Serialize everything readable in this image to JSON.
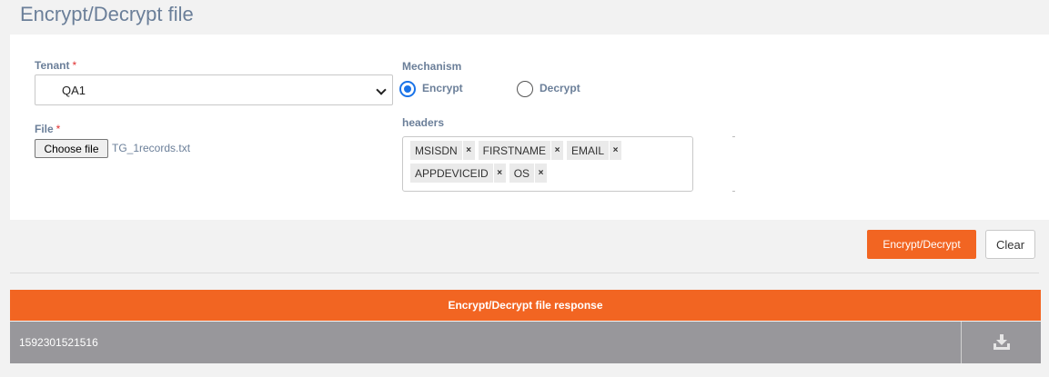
{
  "page": {
    "title": "Encrypt/Decrypt file"
  },
  "form": {
    "tenant": {
      "label": "Tenant",
      "required_mark": "*",
      "selected": "QA1"
    },
    "file": {
      "label": "File",
      "required_mark": "*",
      "button_label": "Choose file",
      "file_name": "TG_1records.txt"
    },
    "mechanism": {
      "label": "Mechanism",
      "options": [
        {
          "label": "Encrypt",
          "checked": true
        },
        {
          "label": "Decrypt",
          "checked": false
        }
      ]
    },
    "headers": {
      "label": "headers",
      "remove_glyph": "×",
      "tags": [
        "MSISDN",
        "FIRSTNAME",
        "EMAIL",
        "APPDEVICEID",
        "OS"
      ]
    }
  },
  "actions": {
    "submit_label": "Encrypt/Decrypt",
    "clear_label": "Clear"
  },
  "response": {
    "header": "Encrypt/Decrypt file response",
    "rows": [
      {
        "value": "1592301521516",
        "action_icon": "download-icon"
      }
    ]
  },
  "colors": {
    "accent": "#f26522",
    "label": "#6b7f99",
    "radio": "#1a73e8",
    "row_bg": "#98979b"
  }
}
